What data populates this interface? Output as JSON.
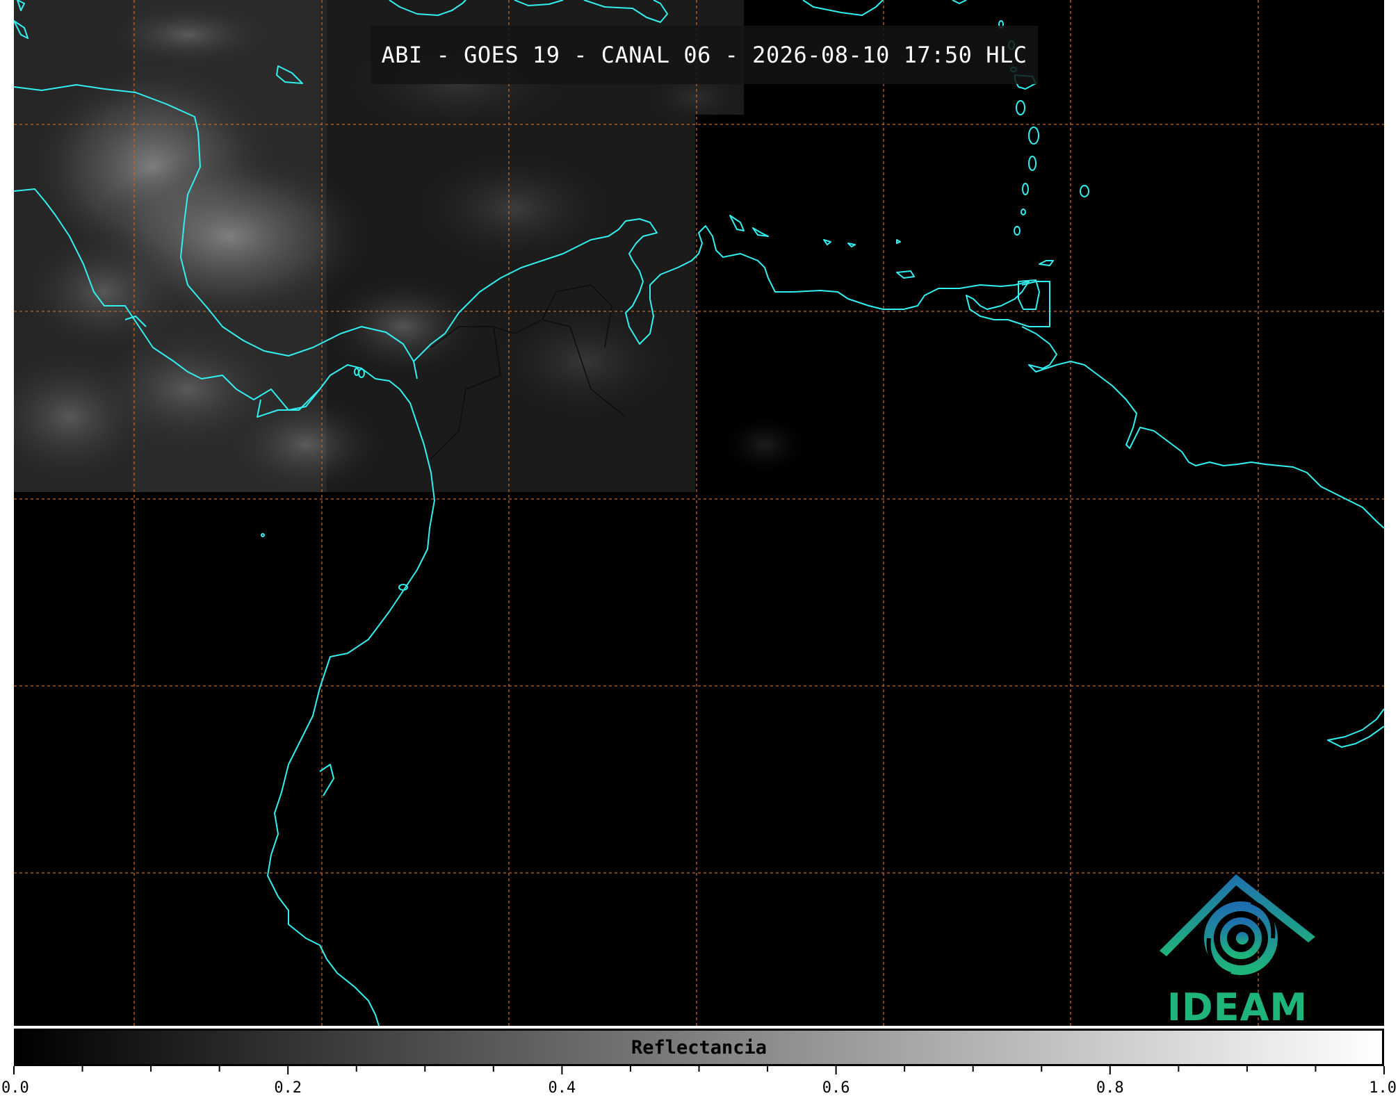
{
  "title": "ABI - GOES 19 - CANAL 06 - 2026-08-10 17:50 HLC",
  "logo": {
    "text": "IDEAM",
    "icon": "ideam-logo-icon",
    "colors": [
      "#1f6fb0",
      "#1fb57a"
    ]
  },
  "colorbar": {
    "label": "Reflectancia",
    "min": 0.0,
    "max": 1.0,
    "major_ticks": [
      0.0,
      0.2,
      0.4,
      0.6,
      0.8,
      1.0
    ],
    "tick_labels": [
      "0.0",
      "0.2",
      "0.4",
      "0.6",
      "0.8",
      "1.0"
    ],
    "minor_step": 0.05,
    "colormap": [
      "#000000",
      "#ffffff"
    ]
  },
  "map": {
    "coastline_color": "#33f0f0",
    "border_color": "#1a1a1a",
    "grid_color": "#c8641e",
    "background": "#000000"
  }
}
